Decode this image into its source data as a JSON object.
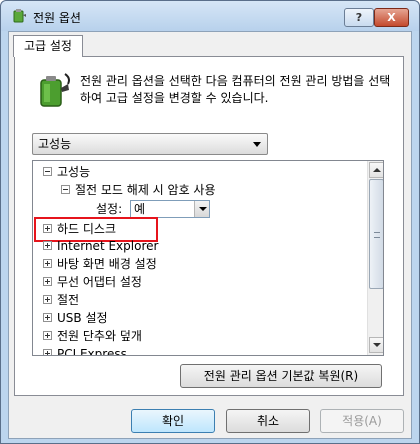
{
  "window": {
    "title": "전원 옵션",
    "help_label": "?",
    "close_label": "X"
  },
  "tab": {
    "label": "고급 설정"
  },
  "description": "전원 관리 옵션을 선택한 다음 컴퓨터의 전원 관리 방법을 선택하여 고급 설정을 변경할 수 있습니다.",
  "plan_select": {
    "value": "고성능"
  },
  "tree": {
    "items": [
      {
        "label": "고성능",
        "expander": "minus"
      },
      {
        "label": "절전 모드 해제 시 암호 사용",
        "expander": "minus"
      },
      {
        "label": "설정:"
      },
      {
        "label": "하드 디스크",
        "expander": "plus",
        "highlighted": true
      },
      {
        "label": "Internet Explorer",
        "expander": "plus"
      },
      {
        "label": "바탕 화면 배경 설정",
        "expander": "plus"
      },
      {
        "label": "무선 어댑터 설정",
        "expander": "plus"
      },
      {
        "label": "절전",
        "expander": "plus"
      },
      {
        "label": "USB 설정",
        "expander": "plus"
      },
      {
        "label": "전원 단추와 덮개",
        "expander": "plus"
      },
      {
        "label": "PCI Express",
        "expander": "plus"
      }
    ],
    "setting_value": "예"
  },
  "buttons": {
    "restore": "전원 관리 옵션 기본값 복원(R)",
    "ok": "확인",
    "cancel": "취소",
    "apply": "적용(A)"
  },
  "colors": {
    "highlight_border": "#e6141c",
    "accent": "#3c7fb1"
  },
  "icons": {
    "title": "power-options-icon",
    "battery": "battery-plug-icon"
  }
}
